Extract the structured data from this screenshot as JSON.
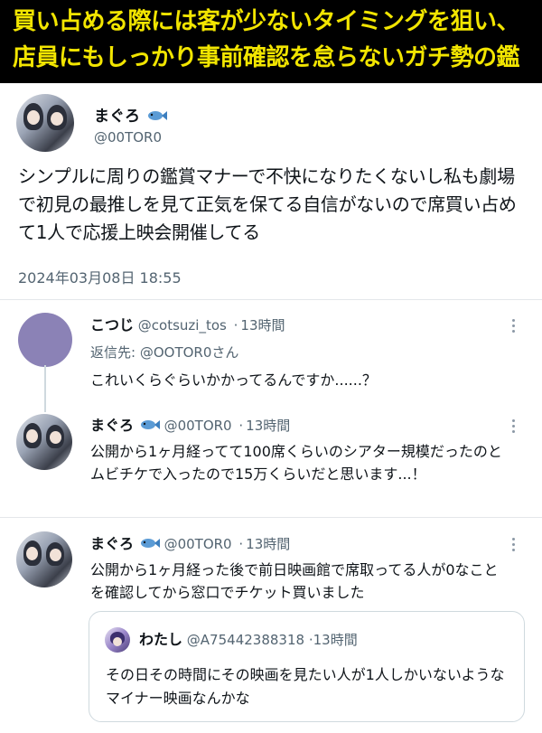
{
  "banner": {
    "line1": "買い占める際には客が少ないタイミングを狙い、",
    "line2": "店員にもしっかり事前確認を怠らないガチ勢の鑑"
  },
  "main_tweet": {
    "name": "まぐろ",
    "handle": "@00TOR0",
    "text": "シンプルに周りの鑑賞マナーで不快になりたくないし私も劇場で初見の最推しを見て正気を保てる自信がないので席買い占めて1人で応援上映会開催してる",
    "date": "2024年03月08日 18:55"
  },
  "replies": [
    {
      "name": "こつじ",
      "handle": "@cotsuzi_tos",
      "time": "13時間",
      "reply_to_label": "返信先:",
      "reply_to_handle": "@OOTOR0さん",
      "text": "これいくらぐらいかかってるんですか......？"
    },
    {
      "name": "まぐろ",
      "handle": "@00TOR0",
      "time": "13時間",
      "text": "公開から1ヶ月経ってて100席くらいのシアター規模だったのとムビチケで入ったので15万くらいだと思います...！"
    },
    {
      "name": "まぐろ",
      "handle": "@00TOR0",
      "time": "13時間",
      "text": "公開から1ヶ月経った後で前日映画館で席取ってる人が0なことを確認してから窓口でチケット買いました"
    }
  ],
  "quote": {
    "name": "わたし",
    "handle": "@A75442388318",
    "time": "13時間",
    "text": "その日その時間にその映画を見たい人が1人しかいないようなマイナー映画なんかな"
  },
  "separator": "·",
  "colors": {
    "banner_bg": "#000000",
    "banner_text": "#f2e500",
    "secondary_text": "#536471",
    "border": "#cfd9de"
  },
  "icons": {
    "fish": "fish-icon",
    "more": "more-dots-icon"
  }
}
